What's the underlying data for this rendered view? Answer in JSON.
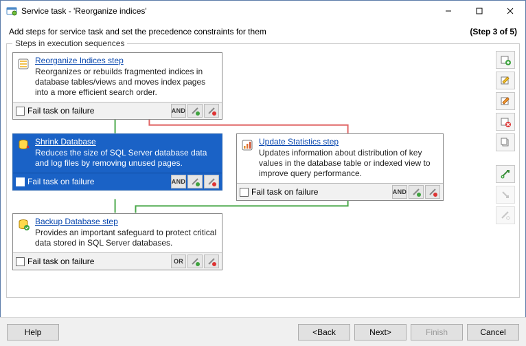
{
  "window": {
    "title": "Service task - 'Reorganize indices'"
  },
  "wizard": {
    "instruction": "Add steps for service task and set the precedence constraints for them",
    "step_indicator": "(Step 3 of 5)"
  },
  "group": {
    "label": "Steps in execution sequences"
  },
  "steps": {
    "reorg": {
      "title": "Reorganize Indices step",
      "desc": "Reorganizes or rebuilds fragmented indices in database tables/views and moves index pages into a more efficient search order.",
      "fail_label": "Fail task on failure",
      "combine": "AND"
    },
    "shrink": {
      "title": "Shrink Database",
      "desc": "Reduces the size of SQL Server database data and log files by removing unused pages.",
      "fail_label": "Fail task on failure",
      "combine": "AND"
    },
    "update": {
      "title": "Update Statistics step",
      "desc": "Updates information about distribution of key values in the database table or indexed view to improve query performance.",
      "fail_label": "Fail task on failure",
      "combine": "AND"
    },
    "backup": {
      "title": "Backup Database step",
      "desc": "Provides an important safeguard to protect critical data stored in SQL Server databases.",
      "fail_label": "Fail task on failure",
      "combine": "OR"
    }
  },
  "buttons": {
    "help": "Help",
    "back": "<Back",
    "next": "Next>",
    "finish": "Finish",
    "cancel": "Cancel"
  }
}
